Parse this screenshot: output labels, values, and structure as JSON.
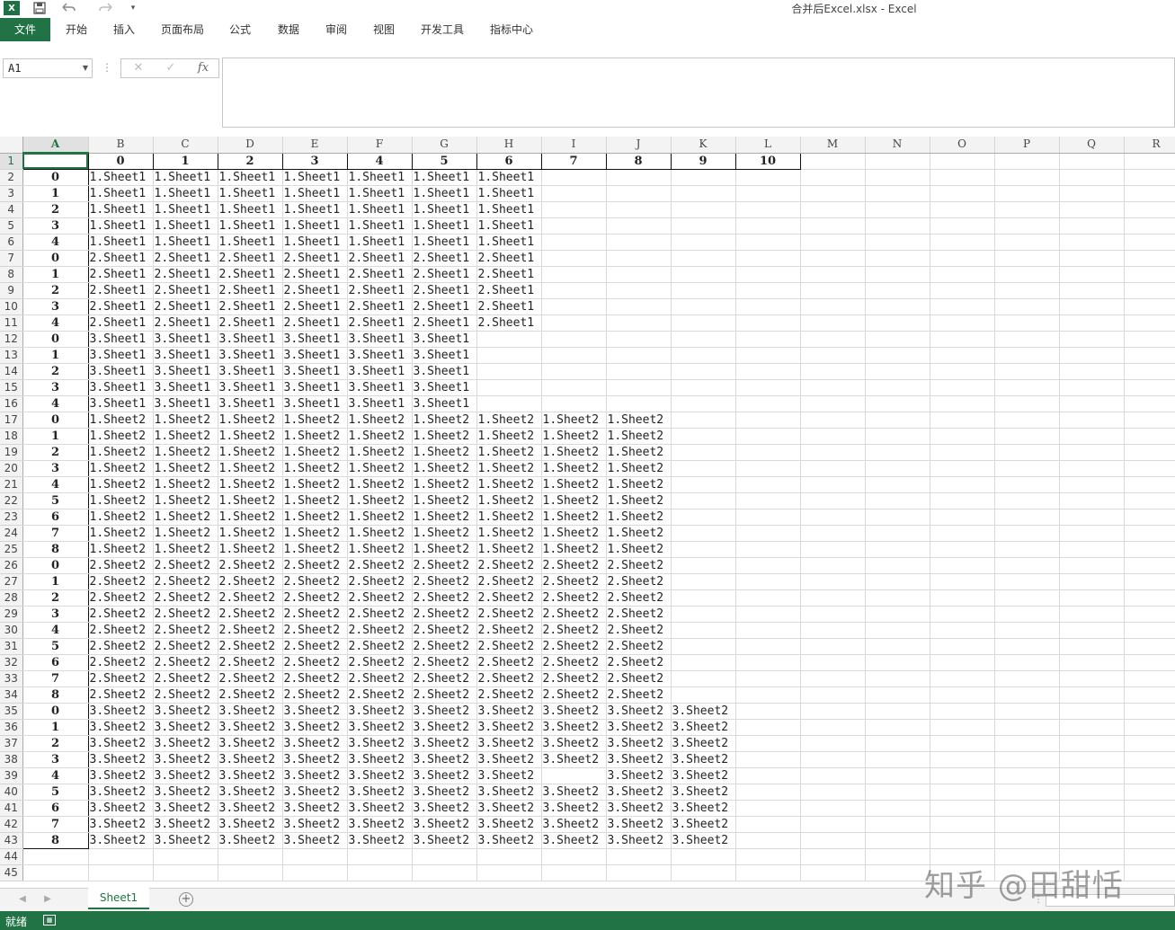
{
  "titlebar": {
    "logo": "X",
    "title": "合并后Excel.xlsx - Excel",
    "icons": [
      "save-icon",
      "undo-icon",
      "redo-icon",
      "customize-quick-access-icon"
    ]
  },
  "ribbon": {
    "tabs": [
      "文件",
      "开始",
      "插入",
      "页面布局",
      "公式",
      "数据",
      "审阅",
      "视图",
      "开发工具",
      "指标中心"
    ]
  },
  "formula_bar": {
    "name_box": "A1",
    "cancel_icon": "✕",
    "enter_icon": "✓",
    "fx_label": "fx",
    "content": ""
  },
  "grid": {
    "columns": [
      "A",
      "B",
      "C",
      "D",
      "E",
      "F",
      "G",
      "H",
      "I",
      "J",
      "K",
      "L",
      "M",
      "N",
      "O",
      "P",
      "Q",
      "R"
    ],
    "selected_cell": "A1",
    "header_row": [
      "",
      "0",
      "1",
      "2",
      "3",
      "4",
      "5",
      "6",
      "7",
      "8",
      "9",
      "10"
    ],
    "blocks": [
      {
        "prefix": "1.Sheet1",
        "indices": [
          "0",
          "1",
          "2",
          "3",
          "4"
        ],
        "filled_cols": 8
      },
      {
        "prefix": "2.Sheet1",
        "indices": [
          "0",
          "1",
          "2",
          "3",
          "4"
        ],
        "filled_cols": 8
      },
      {
        "prefix": "3.Sheet1",
        "indices": [
          "0",
          "1",
          "2",
          "3",
          "4"
        ],
        "filled_cols": 7
      },
      {
        "prefix": "1.Sheet2",
        "indices": [
          "0",
          "1",
          "2",
          "3",
          "4",
          "5",
          "6",
          "7",
          "8"
        ],
        "filled_cols": 10
      },
      {
        "prefix": "2.Sheet2",
        "indices": [
          "0",
          "1",
          "2",
          "3",
          "4",
          "5",
          "6",
          "7",
          "8"
        ],
        "filled_cols": 10
      },
      {
        "prefix": "3.Sheet2",
        "indices": [
          "0",
          "1",
          "2",
          "3",
          "4",
          "5",
          "6",
          "7",
          "8"
        ],
        "filled_cols": 11
      }
    ],
    "blank_cells": [
      {
        "row": 39,
        "col": "I"
      }
    ],
    "extra_rows": [
      "44",
      "45"
    ]
  },
  "sheet_tabs": {
    "tabs": [
      "Sheet1"
    ],
    "active": "Sheet1",
    "add_label": "+"
  },
  "watermark": "知乎 @田甜恬",
  "statusbar": {
    "status": "就绪"
  },
  "colors": {
    "accent": "#217346",
    "gridline": "#dadada",
    "header_bg": "#f3f3f3"
  }
}
